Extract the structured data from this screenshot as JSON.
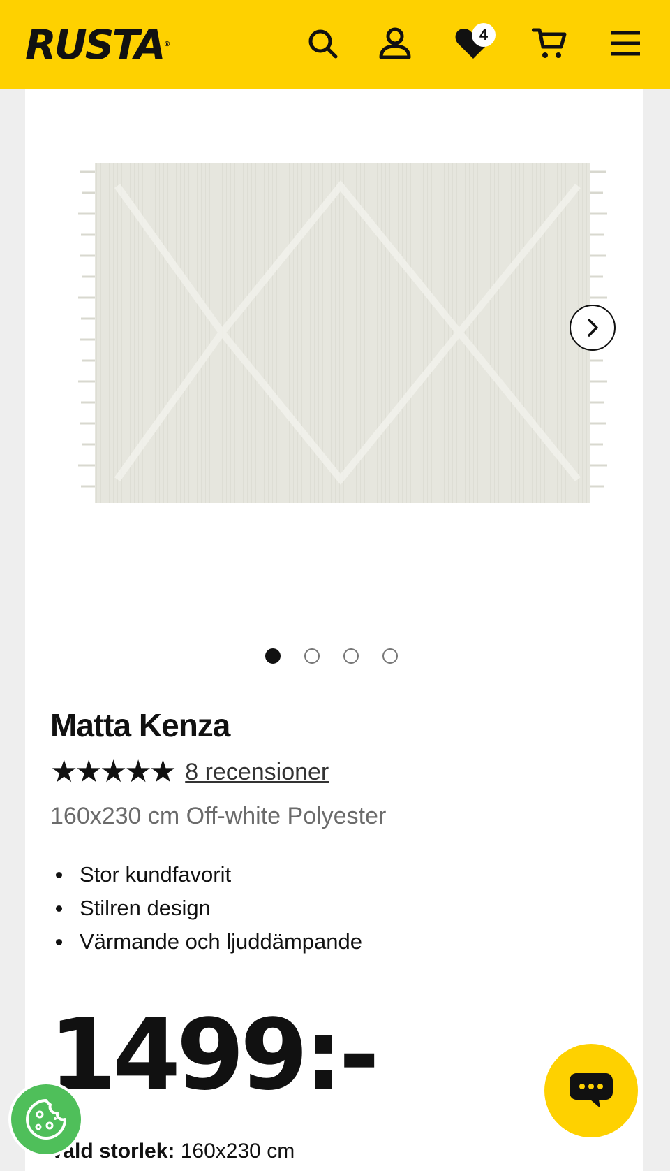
{
  "header": {
    "logo": "RUSTA",
    "logo_mark": "®",
    "wishlist_count": "4",
    "icons": [
      "search-icon",
      "user-icon",
      "heart-icon",
      "cart-icon",
      "menu-icon"
    ],
    "background": "#fed100"
  },
  "gallery": {
    "image_alt": "Matta Kenza",
    "slides_total": 4,
    "active_slide": 1
  },
  "product": {
    "title": "Matta Kenza",
    "stars": "★★★★★",
    "rating_out_of_5": 5,
    "reviews_link": "8 recensioner",
    "variant": "160x230 cm Off-white Polyester",
    "features": [
      "Stor kundfavorit",
      "Stilren design",
      "Värmande och ljuddämpande"
    ],
    "price": "1499:-",
    "selected_size_label": "Vald storlek:",
    "selected_size_value": "160x230 cm"
  },
  "colors": {
    "brand_yellow": "#fed100",
    "cookie_green": "#4fbf5a",
    "text": "#111111",
    "muted_text": "#6b6b6b"
  }
}
